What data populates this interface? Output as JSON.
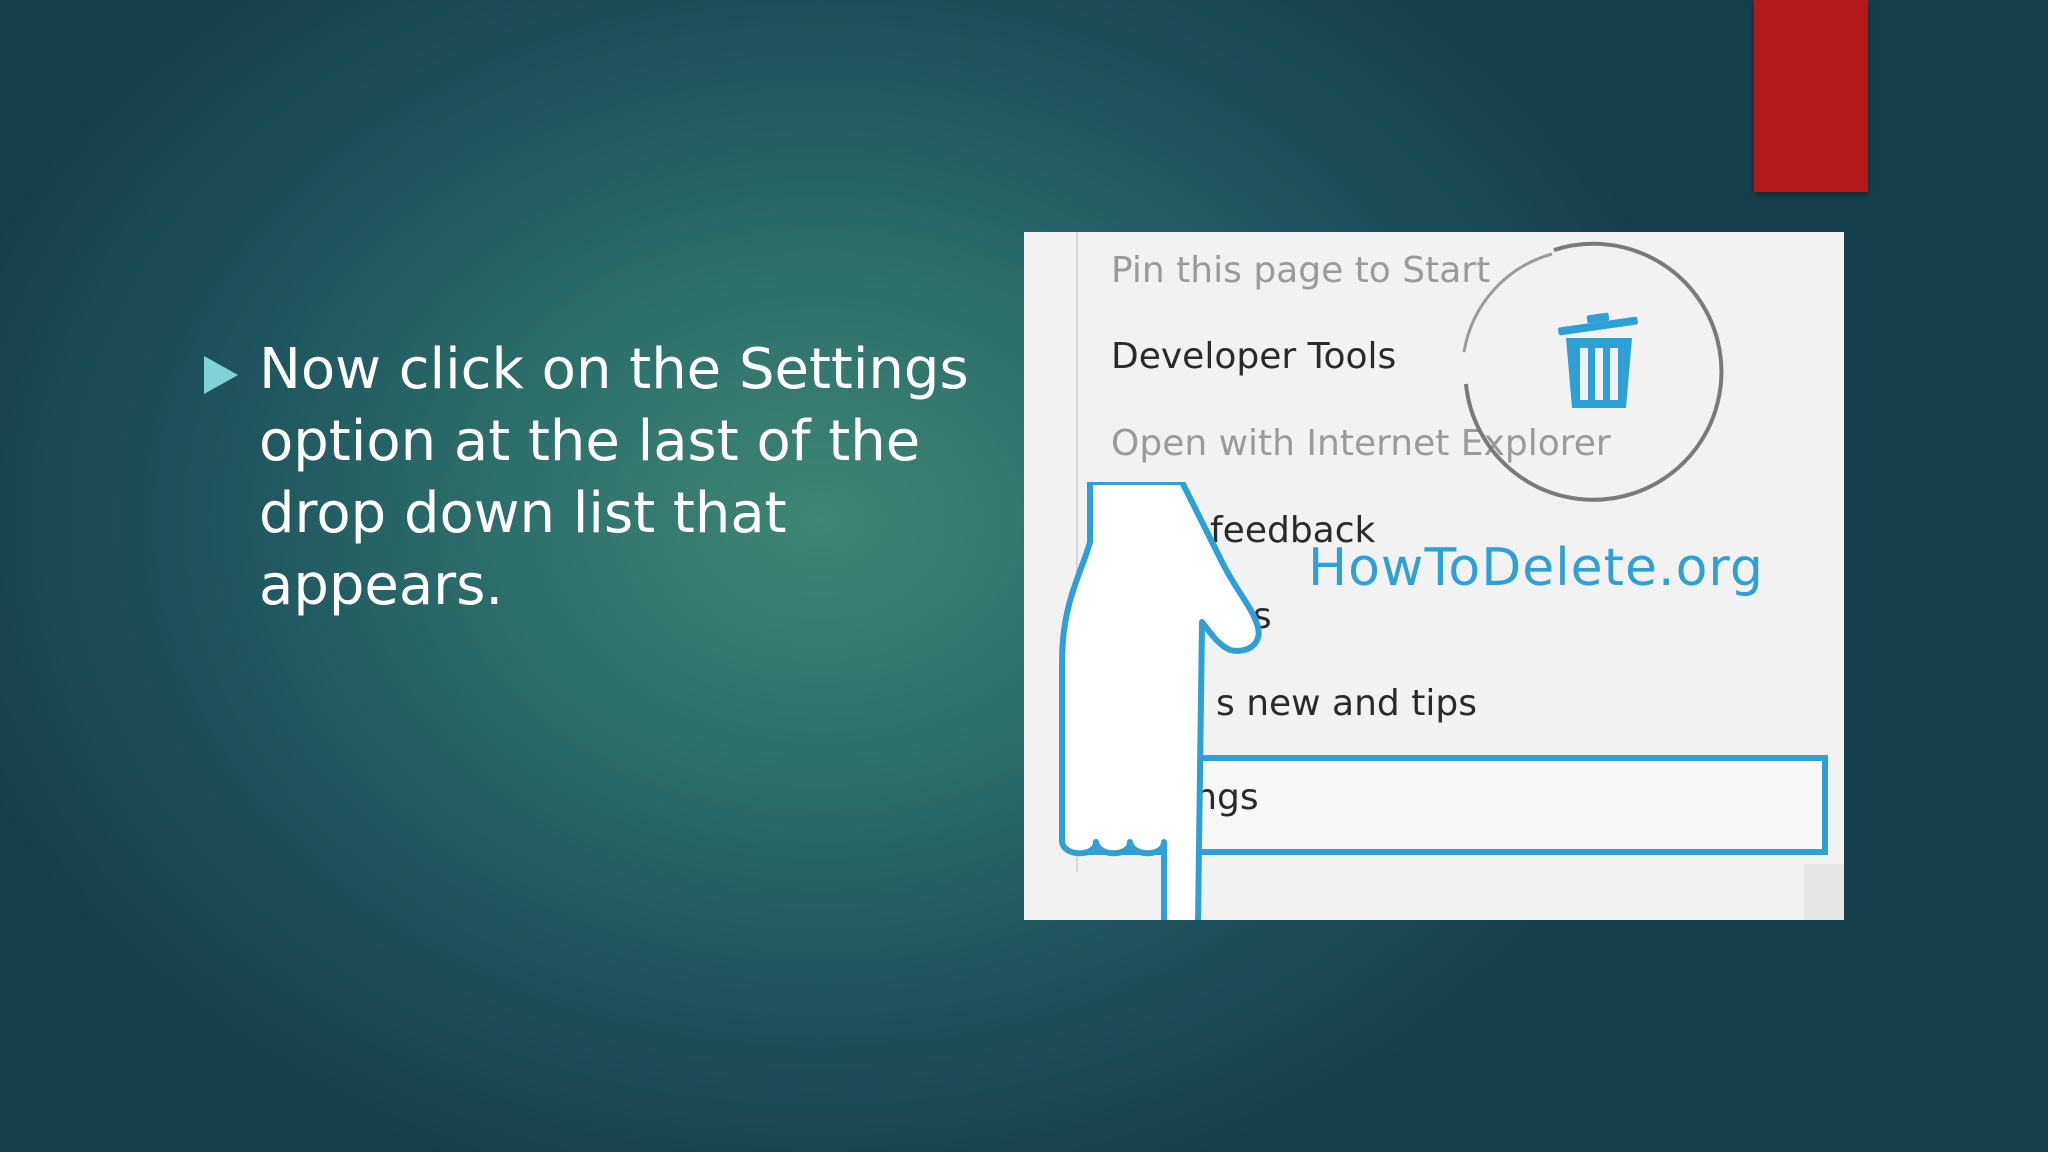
{
  "slide": {
    "bullet_text": "Now click on the Settings option at the last of the drop down list that appears.",
    "colors": {
      "background": "#2d6f6b",
      "accent_bar": "#b31a1a",
      "bullet_arrow": "#7fd3d7",
      "highlight": "#2f9fd8"
    }
  },
  "menu": {
    "items": [
      {
        "label": "Pin this page to Start",
        "state": "disabled"
      },
      {
        "label": "Developer Tools",
        "state": "enabled"
      },
      {
        "label": "Open with Internet Explorer",
        "state": "disabled"
      },
      {
        "label": "feedback",
        "state": "enabled"
      },
      {
        "label": "ns",
        "state": "enabled"
      },
      {
        "label": "s new and tips",
        "state": "enabled"
      }
    ],
    "settings_label": "Settings"
  },
  "watermark": {
    "text": "HowToDelete.org",
    "icon": "trash-icon"
  },
  "pointer": {
    "icon": "hand-pointer-icon"
  }
}
